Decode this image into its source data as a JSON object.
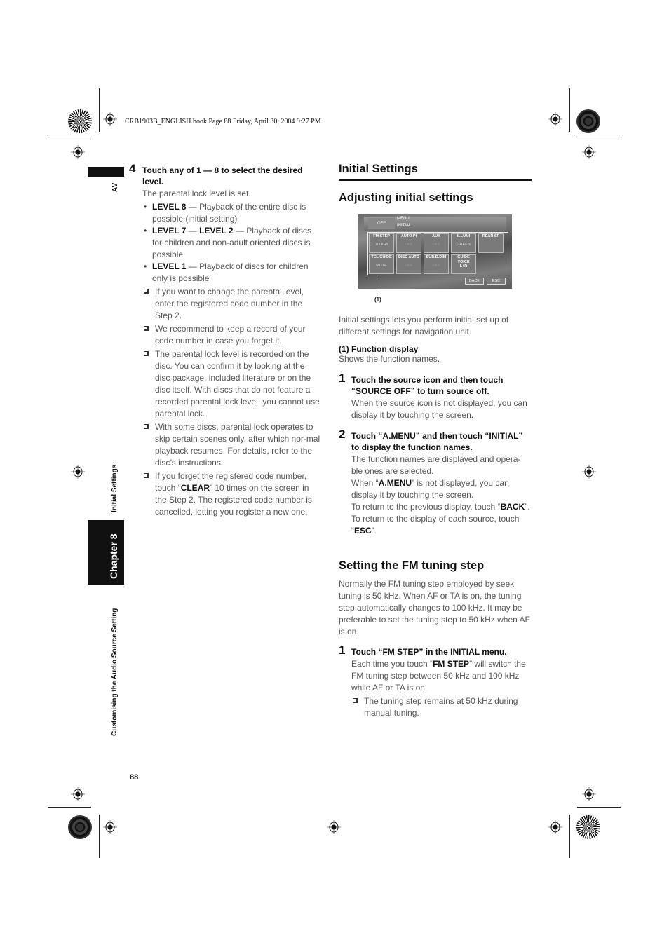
{
  "print_header": "CRB1903B_ENGLISH.book  Page 88  Friday, April 30, 2004  9:27 PM",
  "side_tab": {
    "av": "AV",
    "section": "Initial Settings",
    "chapter": "Chapter 8",
    "chapter_title": "Customising the Audio Source Setting"
  },
  "left": {
    "step4": {
      "number": "4",
      "title": "Touch any of 1 — 8 to select the desired level.",
      "body": "The parental lock level is set.",
      "bullets": [
        {
          "key": "LEVEL 8",
          "text": " — Playback of the entire disc is possible (initial setting)"
        },
        {
          "key": "LEVEL 7",
          "mid": " — ",
          "key2": "LEVEL 2",
          "text": " — Playback of discs for children and non-adult oriented discs is possible"
        },
        {
          "key": "LEVEL 1",
          "text": " — Playback of discs for children only is possible"
        }
      ],
      "notes": [
        "If you want to change the parental level, enter the registered code number in the Step 2.",
        "We recommend to keep a record of your code number in case you forget it.",
        "The parental lock level is recorded on the disc. You can confirm it by looking at the disc package, included literature or on the disc itself. With discs that do not feature a recorded parental lock level, you cannot use parental lock.",
        "With some discs, parental lock operates to skip certain scenes only, after which nor-mal playback resumes. For details, refer to the disc’s instructions."
      ],
      "note_clear": {
        "pre": "If you forget the registered code number, touch “",
        "key": "CLEAR",
        "post": "” 10 times on the screen in the Step 2. The registered code number is cancelled, letting you register a new one."
      }
    }
  },
  "right": {
    "section_title": "Initial Settings",
    "sub1": "Adjusting initial settings",
    "screen": {
      "off": "OFF",
      "menu": "MENU",
      "initial": "INITIAL",
      "buttons": [
        {
          "label": "FM STEP",
          "value": "100kHz"
        },
        {
          "label": "AUTO PI",
          "value": "OFF"
        },
        {
          "label": "AUX",
          "value": "OFF"
        },
        {
          "label": "ILLUMI",
          "value": "GREEN"
        },
        {
          "label": "REAR SP",
          "value": ""
        },
        {
          "label": "TEL/GUIDE",
          "value": "MUTE"
        },
        {
          "label": "DISC AUTO",
          "value": "OFF"
        },
        {
          "label": "SUB.D.DIM",
          "value": "OFF"
        },
        {
          "label": "GUIDE VOICE",
          "value": "L+R"
        }
      ],
      "back": "BACK",
      "esc": "ESC"
    },
    "callout": "(1)",
    "intro": "Initial settings lets you perform initial set up of different settings for navigation unit.",
    "function_display_title": "(1) Function display",
    "function_display_body": "Shows the function names.",
    "step1": {
      "number": "1",
      "title": "Touch the source icon and then touch “SOURCE OFF” to turn source off.",
      "body": "When the source icon is not displayed, you can display it by touching the screen."
    },
    "step2": {
      "number": "2",
      "title": "Touch “A.MENU” and then touch “INITIAL” to display the function names.",
      "body1": "The function names are displayed and opera-ble ones are selected.",
      "body2_pre": "When “",
      "body2_key": "A.MENU",
      "body2_post": "” is not displayed, you can display it by touching the screen.",
      "body3_pre": "To return to the previous display, touch “",
      "body3_key": "BACK",
      "body3_post": "”.",
      "body4_pre": "To return to the display of each source, touch “",
      "body4_key": "ESC",
      "body4_post": "”."
    },
    "sub2": "Setting the FM tuning step",
    "fm_intro": "Normally the FM tuning step employed by seek tuning is 50 kHz. When AF or TA is on, the tuning step automatically changes to 100 kHz. It may be preferable to set the tuning step to 50 kHz when AF is on.",
    "fm_step1": {
      "number": "1",
      "title": "Touch “FM STEP” in the INITIAL menu.",
      "body_pre": "Each time you touch “",
      "body_key": "FM STEP",
      "body_post": "” will switch the FM tuning step between 50 kHz and 100 kHz while AF or TA is on.",
      "note": "The tuning step remains at 50 kHz during manual tuning."
    }
  },
  "page_number": "88"
}
